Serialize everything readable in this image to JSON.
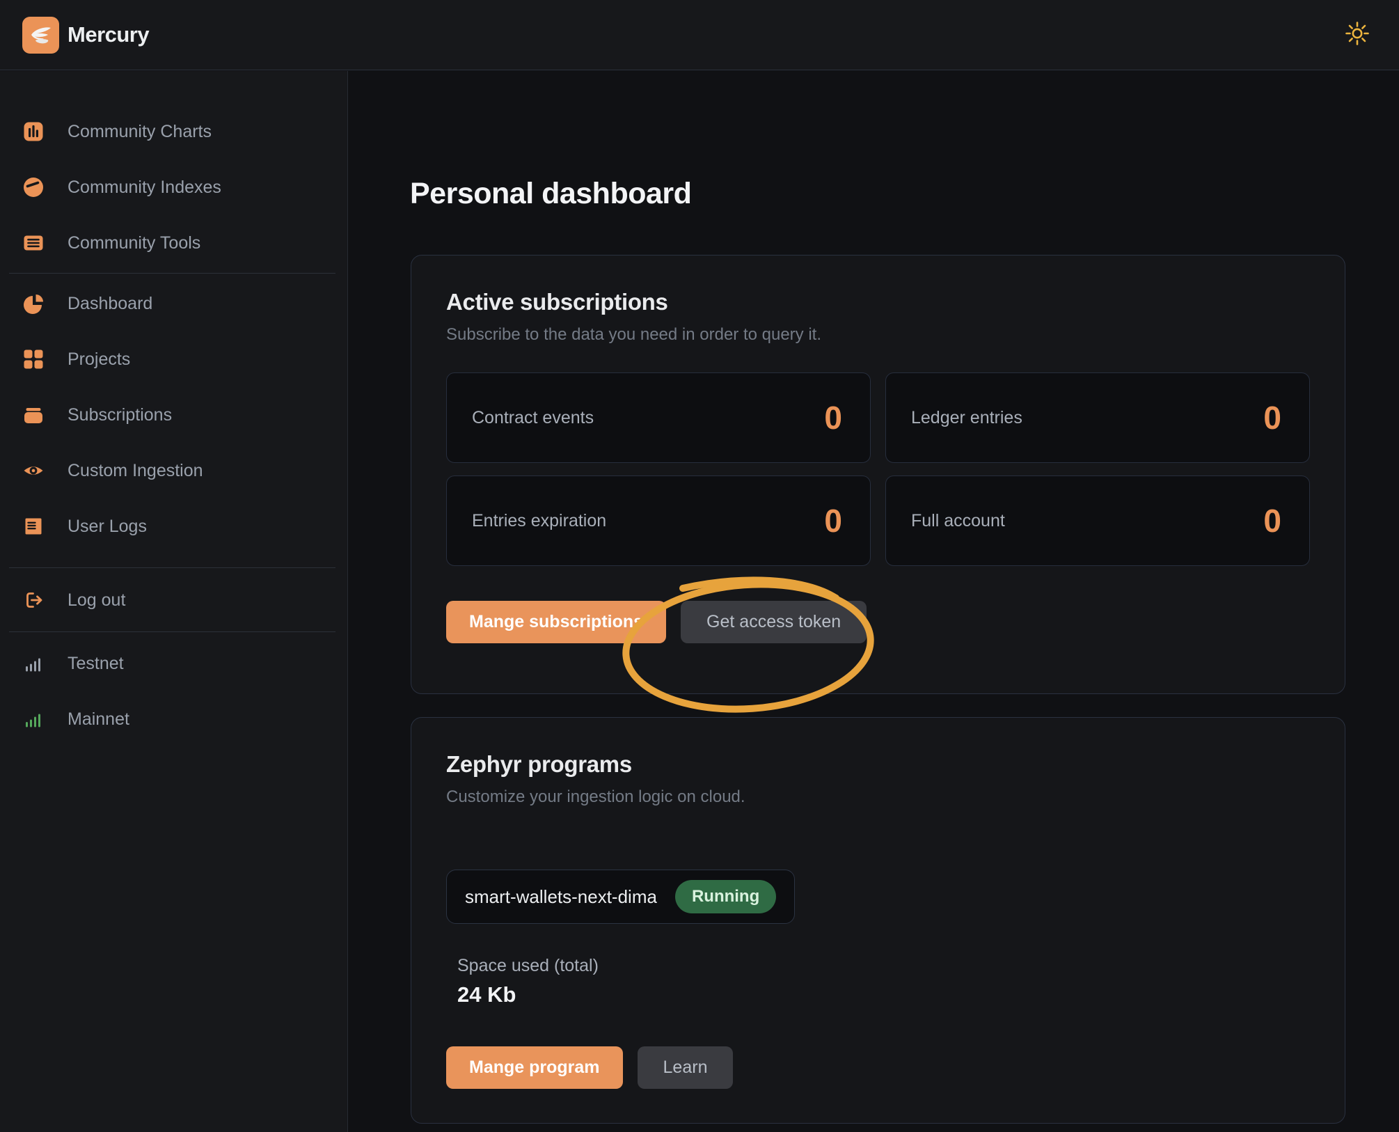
{
  "brand": {
    "name": "Mercury",
    "logo_icon": "wing-icon"
  },
  "topbar": {
    "theme_toggle_icon": "sun-icon"
  },
  "sidebar": {
    "community_items": [
      {
        "label": "Community Charts",
        "icon": "bar-chart-icon"
      },
      {
        "label": "Community Indexes",
        "icon": "gauge-icon"
      },
      {
        "label": "Community Tools",
        "icon": "list-card-icon"
      }
    ],
    "workspace_items": [
      {
        "label": "Dashboard",
        "icon": "pie-chart-icon"
      },
      {
        "label": "Projects",
        "icon": "grid-icon"
      },
      {
        "label": "Subscriptions",
        "icon": "archive-icon"
      },
      {
        "label": "Custom Ingestion",
        "icon": "eye-icon"
      },
      {
        "label": "User Logs",
        "icon": "log-file-icon"
      }
    ],
    "logout": {
      "label": "Log out",
      "icon": "logout-icon"
    },
    "networks": [
      {
        "label": "Testnet",
        "icon": "signal-bars-icon",
        "bar_color": "#9aa1ac"
      },
      {
        "label": "Mainnet",
        "icon": "signal-bars-icon",
        "bar_color": "#55a85c"
      }
    ]
  },
  "main": {
    "page_title": "Personal dashboard",
    "active_subscriptions": {
      "title": "Active subscriptions",
      "subtitle": "Subscribe to the data you need in order to query it.",
      "stats": [
        {
          "label": "Contract events",
          "value": "0"
        },
        {
          "label": "Ledger entries",
          "value": "0"
        },
        {
          "label": "Entries expiration",
          "value": "0"
        },
        {
          "label": "Full account",
          "value": "0"
        }
      ],
      "manage_button": "Mange subscriptions",
      "token_button": "Get access token"
    },
    "zephyr_programs": {
      "title": "Zephyr programs",
      "subtitle": "Customize your ingestion logic on cloud.",
      "program_name": "smart-wallets-next-dima",
      "program_status": "Running",
      "space_used_label": "Space used (total)",
      "space_used_value": "24 Kb",
      "manage_button": "Mange program",
      "learn_button": "Learn"
    }
  },
  "colors": {
    "accent_orange": "#eb9357",
    "status_green_bg": "#2f6b44",
    "status_green_text": "#d9f2de",
    "annotation_yellow": "#e7a33c",
    "theme_sun_gold": "#ecb43e"
  }
}
